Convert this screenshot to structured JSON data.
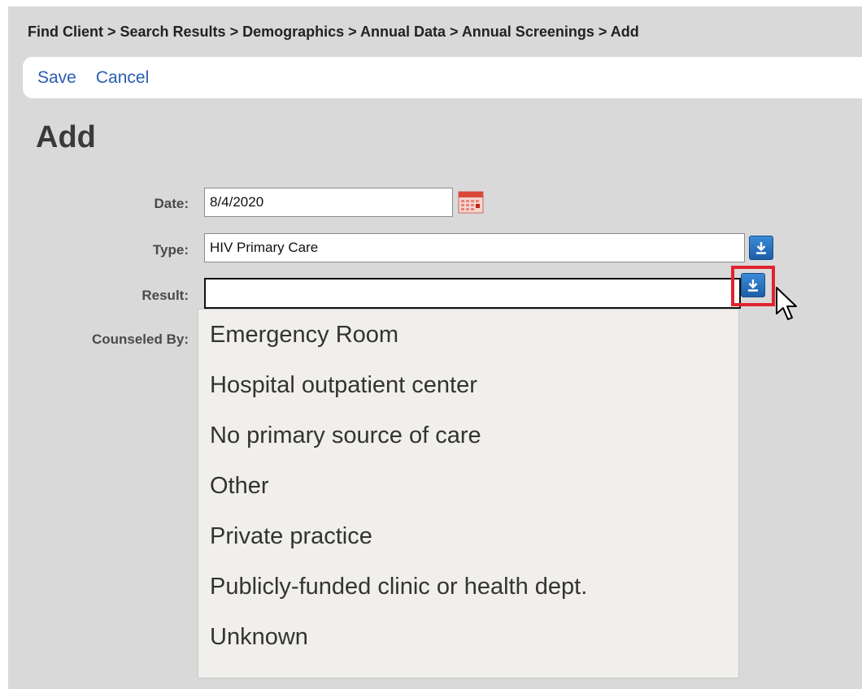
{
  "breadcrumb": "Find Client > Search Results > Demographics > Annual Data > Annual Screenings > Add",
  "actions": {
    "save": "Save",
    "cancel": "Cancel"
  },
  "page_title": "Add",
  "form": {
    "date": {
      "label": "Date:",
      "value": "8/4/2020"
    },
    "type": {
      "label": "Type:",
      "value": "HIV Primary Care"
    },
    "result": {
      "label": "Result:",
      "value": ""
    },
    "counseled_by": {
      "label": "Counseled By:"
    }
  },
  "result_options": [
    "Emergency Room",
    "Hospital outpatient center",
    "No primary source of care",
    "Other",
    "Private practice",
    "Publicly-funded clinic or health dept.",
    "Unknown"
  ],
  "icons": {
    "calendar": "calendar-icon",
    "dropdown": "download-arrow-icon",
    "cursor": "mouse-pointer-icon"
  },
  "colors": {
    "link": "#2a5db0",
    "dropdown_button": "#1d5fa8",
    "highlight": "#e0242e",
    "dropdown_bg": "#f1efec"
  }
}
